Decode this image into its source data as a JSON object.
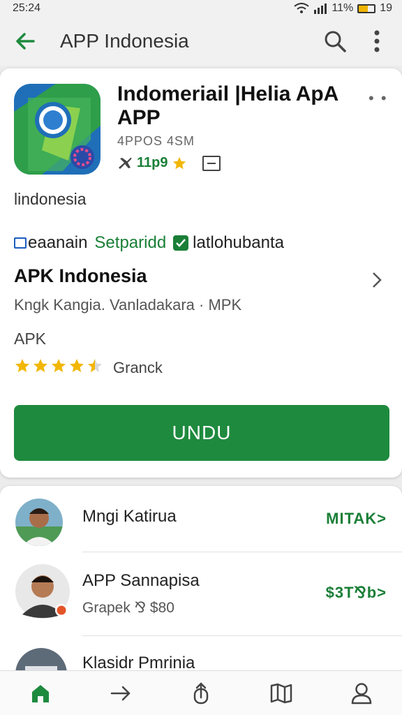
{
  "status_bar": {
    "time": "25:24",
    "battery": "11%",
    "battery_level": 0.6,
    "extra": "19"
  },
  "app_bar": {
    "title": "APP Indonesia"
  },
  "app": {
    "name": "Indomeriail |Helia ApA APP",
    "subtitle": "4PPOS 4SM",
    "meta_value": "11p9",
    "region": "lindonesia"
  },
  "features": {
    "first": "eaanain",
    "second": "Setparidd",
    "third": "latlohubanta"
  },
  "section": {
    "title": "APK Indonesia",
    "subtitle": "Kngk Kangia. Vanladakara · MPK"
  },
  "apk_label": "APK",
  "rating": {
    "stars": 4.5,
    "label": "Granck"
  },
  "install_label": "UNDU",
  "list": [
    {
      "name": "Mngi Katirua",
      "sub": "",
      "action": "MITAK>"
    },
    {
      "name": "APP Sannapisa",
      "sub": "Grapek  ⅋ $80",
      "action": "$3T⅋b>"
    },
    {
      "name": "Klasidr Pmrinia",
      "sub": "",
      "action": ""
    }
  ],
  "colors": {
    "accent_green": "#1e8a3e",
    "star_yellow": "#f2b705",
    "app_bar_bg": "#f1f1f1"
  },
  "icons": {
    "back": "arrow-left-icon",
    "search": "search-icon",
    "more": "more-vert-icon",
    "nav": [
      "home-icon",
      "forward-icon",
      "share-icon",
      "book-icon",
      "person-icon"
    ]
  }
}
